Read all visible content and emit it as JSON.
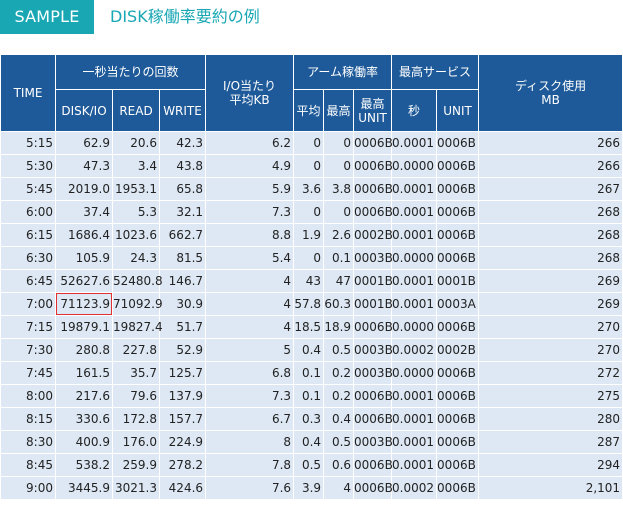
{
  "header": {
    "badge": "SAMPLE",
    "title": "DISK稼働率要約の例"
  },
  "columns": {
    "time": "TIME",
    "per_sec_group": "一秒当たりの回数",
    "disk_io": "DISK/IO",
    "read": "READ",
    "write": "WRITE",
    "io_avg_kb": "I/O当たり\n平均KB",
    "arm_group": "アーム稼働率",
    "avg": "平均",
    "max": "最高",
    "max_unit": "最高\nUNIT",
    "service_group": "最高サービス",
    "sec": "秒",
    "unit": "UNIT",
    "disk_used": "ディスク使用\nMB"
  },
  "rows": [
    {
      "time": "5:15",
      "disk_io": "62.9",
      "read": "20.6",
      "write": "42.3",
      "io_kb": "6.2",
      "avg": "0",
      "max": "0",
      "max_unit": "0006B",
      "sec": "0.0001",
      "unit": "0006B",
      "mb": "266"
    },
    {
      "time": "5:30",
      "disk_io": "47.3",
      "read": "3.4",
      "write": "43.8",
      "io_kb": "4.9",
      "avg": "0",
      "max": "0",
      "max_unit": "0006B",
      "sec": "0.0000",
      "unit": "0006B",
      "mb": "266"
    },
    {
      "time": "5:45",
      "disk_io": "2019.0",
      "read": "1953.1",
      "write": "65.8",
      "io_kb": "5.9",
      "avg": "3.6",
      "max": "3.8",
      "max_unit": "0006B",
      "sec": "0.0001",
      "unit": "0006B",
      "mb": "267"
    },
    {
      "time": "6:00",
      "disk_io": "37.4",
      "read": "5.3",
      "write": "32.1",
      "io_kb": "7.3",
      "avg": "0",
      "max": "0",
      "max_unit": "0006B",
      "sec": "0.0001",
      "unit": "0006B",
      "mb": "268"
    },
    {
      "time": "6:15",
      "disk_io": "1686.4",
      "read": "1023.6",
      "write": "662.7",
      "io_kb": "8.8",
      "avg": "1.9",
      "max": "2.6",
      "max_unit": "0002B",
      "sec": "0.0001",
      "unit": "0006B",
      "mb": "268"
    },
    {
      "time": "6:30",
      "disk_io": "105.9",
      "read": "24.3",
      "write": "81.5",
      "io_kb": "5.4",
      "avg": "0",
      "max": "0.1",
      "max_unit": "0003B",
      "sec": "0.0000",
      "unit": "0006B",
      "mb": "268"
    },
    {
      "time": "6:45",
      "disk_io": "52627.6",
      "read": "52480.8",
      "write": "146.7",
      "io_kb": "4",
      "avg": "43",
      "max": "47",
      "max_unit": "0001B",
      "sec": "0.0001",
      "unit": "0001B",
      "mb": "269"
    },
    {
      "time": "7:00",
      "disk_io": "71123.9",
      "read": "71092.9",
      "write": "30.9",
      "io_kb": "4",
      "avg": "57.8",
      "max": "60.3",
      "max_unit": "0001B",
      "sec": "0.0001",
      "unit": "0003A",
      "mb": "269"
    },
    {
      "time": "7:15",
      "disk_io": "19879.1",
      "read": "19827.4",
      "write": "51.7",
      "io_kb": "4",
      "avg": "18.5",
      "max": "18.9",
      "max_unit": "0006B",
      "sec": "0.0000",
      "unit": "0006B",
      "mb": "270"
    },
    {
      "time": "7:30",
      "disk_io": "280.8",
      "read": "227.8",
      "write": "52.9",
      "io_kb": "5",
      "avg": "0.4",
      "max": "0.5",
      "max_unit": "0003B",
      "sec": "0.0002",
      "unit": "0002B",
      "mb": "270"
    },
    {
      "time": "7:45",
      "disk_io": "161.5",
      "read": "35.7",
      "write": "125.7",
      "io_kb": "6.8",
      "avg": "0.1",
      "max": "0.2",
      "max_unit": "0003B",
      "sec": "0.0000",
      "unit": "0006B",
      "mb": "272"
    },
    {
      "time": "8:00",
      "disk_io": "217.6",
      "read": "79.6",
      "write": "137.9",
      "io_kb": "7.3",
      "avg": "0.1",
      "max": "0.2",
      "max_unit": "0006B",
      "sec": "0.0001",
      "unit": "0006B",
      "mb": "275"
    },
    {
      "time": "8:15",
      "disk_io": "330.6",
      "read": "172.8",
      "write": "157.7",
      "io_kb": "6.7",
      "avg": "0.3",
      "max": "0.4",
      "max_unit": "0006B",
      "sec": "0.0001",
      "unit": "0006B",
      "mb": "280"
    },
    {
      "time": "8:30",
      "disk_io": "400.9",
      "read": "176.0",
      "write": "224.9",
      "io_kb": "8",
      "avg": "0.4",
      "max": "0.5",
      "max_unit": "0003B",
      "sec": "0.0001",
      "unit": "0006B",
      "mb": "287"
    },
    {
      "time": "8:45",
      "disk_io": "538.2",
      "read": "259.9",
      "write": "278.2",
      "io_kb": "7.8",
      "avg": "0.5",
      "max": "0.6",
      "max_unit": "0006B",
      "sec": "0.0001",
      "unit": "0006B",
      "mb": "294"
    },
    {
      "time": "9:00",
      "disk_io": "3445.9",
      "read": "3021.3",
      "write": "424.6",
      "io_kb": "7.6",
      "avg": "3.9",
      "max": "4",
      "max_unit": "0006B",
      "sec": "0.0002",
      "unit": "0006B",
      "mb": "2,101"
    }
  ],
  "highlight": {
    "row": 7,
    "column": "disk_io",
    "color": "#e03030"
  },
  "colors": {
    "accent": "#19a7b4",
    "header_bg": "#1e5a99",
    "row_bg": "#dde8f4"
  }
}
